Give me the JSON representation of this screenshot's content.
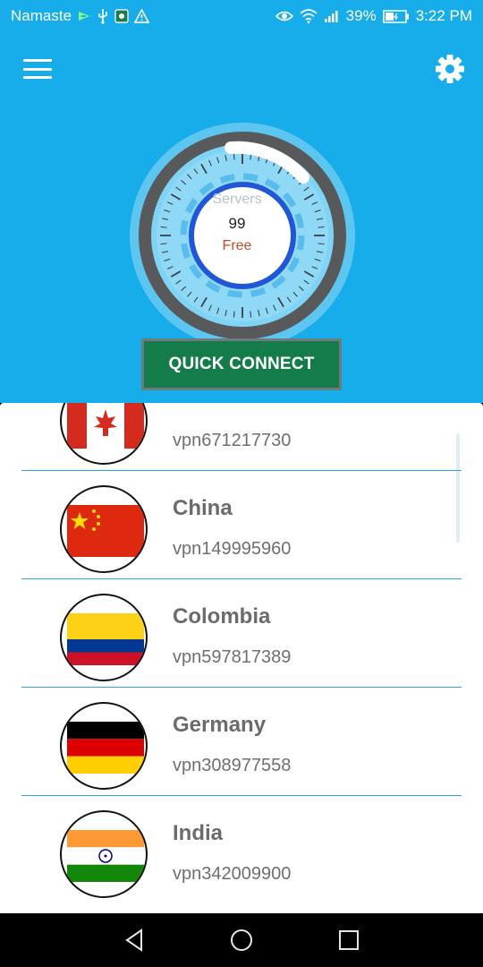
{
  "status_bar": {
    "carrier": "Namaste",
    "battery": "39%",
    "time": "3:22 PM",
    "icons": [
      "vpn-key-icon",
      "usb-icon",
      "app-badge-icon",
      "warning-icon",
      "eye-icon",
      "wifi-icon",
      "signal-icon",
      "battery-icon"
    ]
  },
  "header": {
    "menu_icon": "hamburger-menu-icon",
    "settings_icon": "gear-icon",
    "dial": {
      "label": "Servers",
      "value": "99",
      "tier": "Free"
    },
    "quick_connect_label": "QUICK CONNECT"
  },
  "servers": [
    {
      "country": "",
      "id": "vpn671217730",
      "flag": "canada"
    },
    {
      "country": "China",
      "id": "vpn149995960",
      "flag": "china"
    },
    {
      "country": "Colombia",
      "id": "vpn597817389",
      "flag": "colombia"
    },
    {
      "country": "Germany",
      "id": "vpn308977558",
      "flag": "germany"
    },
    {
      "country": "India",
      "id": "vpn342009900",
      "flag": "india"
    }
  ],
  "colors": {
    "primary": "#17ADEA",
    "button": "#137C4A",
    "divider": "#33A3D8",
    "text_muted": "#6b6b6b",
    "tier_red": "#c94a2a"
  },
  "nav": [
    "back-icon",
    "home-icon",
    "recents-icon"
  ]
}
